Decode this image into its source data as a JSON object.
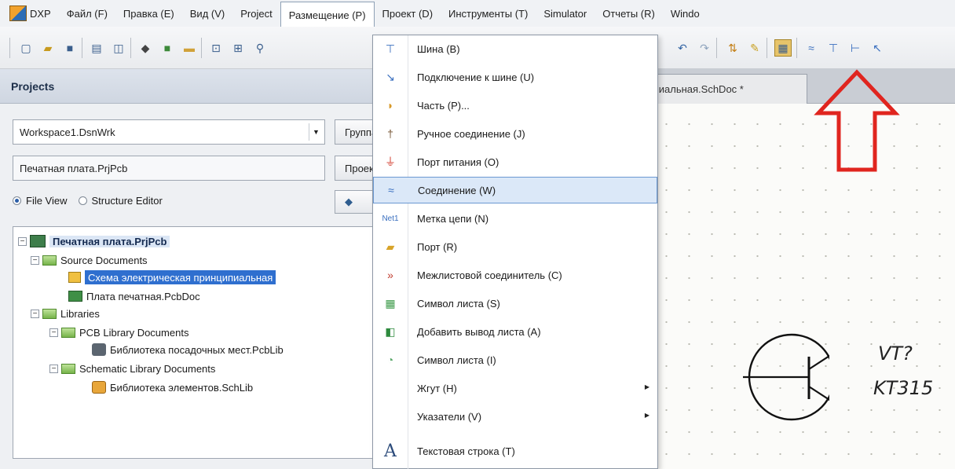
{
  "menubar": {
    "items": [
      "DXP",
      "Файл (F)",
      "Правка (E)",
      "Вид (V)",
      "Project",
      "Размещение (P)",
      "Проект (D)",
      "Инструменты (T)",
      "Simulator",
      "Отчеты (R)",
      "Windo"
    ]
  },
  "projects_panel": {
    "title": "Projects",
    "workspace_value": "Workspace1.DsnWrk",
    "project_value": "Печатная плата.PrjPcb",
    "workspace_button": "Группа",
    "project_button": "Проект",
    "radio_file_view": "File View",
    "radio_structure_editor": "Structure Editor"
  },
  "tree": [
    "Печатная плата.PrjPcb",
    "Source Documents",
    "Схема электрическая принципиальная",
    "Плата печатная.PcbDoc",
    "Libraries",
    "PCB Library Documents",
    "Библиотека посадочных мест.PcbLib",
    "Schematic Library Documents",
    "Библиотека элементов.SchLib"
  ],
  "document": {
    "tab_label": "ципиальная.SchDoc *",
    "component_ref": "VT?",
    "component_value": "KT315"
  },
  "dropdown": {
    "items": [
      "Шина (B)",
      "Подключение к шине (U)",
      "Часть (P)...",
      "Ручное соединение (J)",
      "Порт питания (O)",
      "Соединение (W)",
      "Метка цепи (N)",
      "Порт (R)",
      "Межлистовой соединитель (C)",
      "Символ листа (S)",
      "Добавить вывод листа (A)",
      "Символ листа (I)",
      "Жгут (H)",
      "Указатели (V)",
      "Текстовая строка (T)"
    ],
    "net_label_icon_text": "Net1",
    "text_icon_glyph": "A"
  },
  "colors": {
    "accent_highlight": "#dbe8f8",
    "selection_blue": "#2f6fcf",
    "annotation_red": "#e0251f"
  }
}
